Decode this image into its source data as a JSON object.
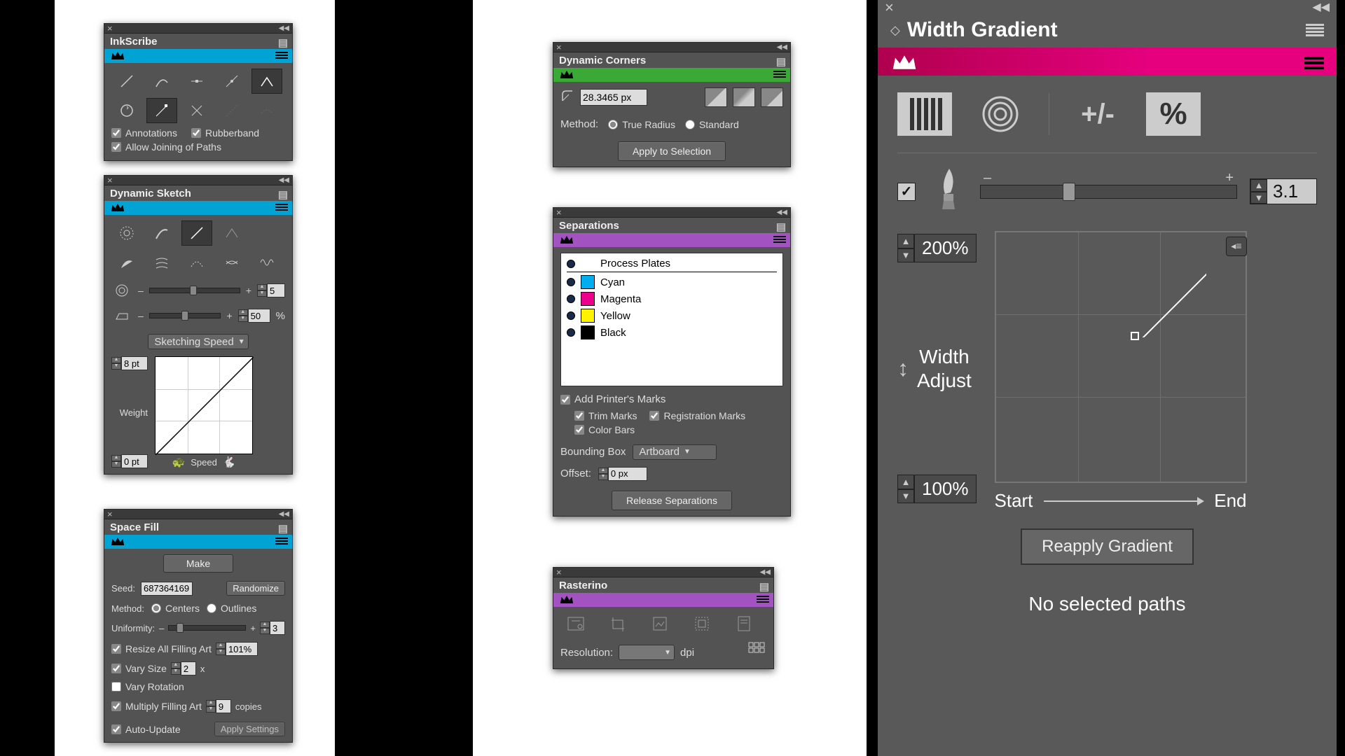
{
  "inkscribe": {
    "title": "InkScribe",
    "brand_color": "#00a3d4",
    "opts": {
      "annotations": "Annotations",
      "rubberband": "Rubberband",
      "joining": "Allow Joining of Paths"
    }
  },
  "dynsketch": {
    "title": "Dynamic Sketch",
    "brand_color": "#00a3d4",
    "val_a": "5",
    "val_b": "50",
    "unit_b": "%",
    "mode_label": "Sketching Speed",
    "pt_top": "8 pt",
    "pt_bot": "0 pt",
    "weight_label": "Weight",
    "speed_label": "Speed"
  },
  "spacefill": {
    "title": "Space Fill",
    "brand_color": "#00a3d4",
    "make": "Make",
    "seed_label": "Seed:",
    "seed_val": "687364169",
    "randomize": "Randomize",
    "method_label": "Method:",
    "centers": "Centers",
    "outlines": "Outlines",
    "uniformity_label": "Uniformity:",
    "uniformity_val": "3",
    "resize_label": "Resize All Filling Art",
    "resize_val": "101%",
    "vary_size_label": "Vary Size",
    "vary_size_val": "2",
    "vary_size_unit": "x",
    "vary_rotation": "Vary Rotation",
    "multiply_label": "Multiply Filling Art",
    "multiply_val": "9",
    "multiply_unit": "copies",
    "auto_update": "Auto-Update",
    "apply": "Apply Settings"
  },
  "dyncorners": {
    "title": "Dynamic Corners",
    "brand_color": "#3aa935",
    "radius_val": "28.3465 px",
    "method_label": "Method:",
    "true_radius": "True Radius",
    "standard": "Standard",
    "apply": "Apply to Selection"
  },
  "separations": {
    "title": "Separations",
    "brand_color": "#a352c1",
    "header": "Process Plates",
    "plates": [
      {
        "name": "Cyan",
        "color": "#00aeef"
      },
      {
        "name": "Magenta",
        "color": "#ec008c"
      },
      {
        "name": "Yellow",
        "color": "#fff200"
      },
      {
        "name": "Black",
        "color": "#000000"
      }
    ],
    "add_marks": "Add Printer's Marks",
    "trim": "Trim Marks",
    "reg": "Registration Marks",
    "bars": "Color Bars",
    "bbox_label": "Bounding Box",
    "bbox_val": "Artboard",
    "offset_label": "Offset:",
    "offset_val": "0 px",
    "release": "Release Separations"
  },
  "rasterino": {
    "title": "Rasterino",
    "brand_color": "#a352c1",
    "res_label": "Resolution:",
    "res_val": "",
    "res_unit": "dpi"
  },
  "widthgrad": {
    "title": "Width Gradient",
    "brush_val": "3.1",
    "pct_top": "200%",
    "pct_bot": "100%",
    "adjust_label": "Width\nAdjust",
    "start": "Start",
    "end": "End",
    "reapply": "Reapply Gradient",
    "status": "No selected paths"
  },
  "chart_data": [
    {
      "type": "line",
      "title": "Dynamic Sketch weight/speed curve",
      "xlabel": "Speed",
      "ylabel": "Weight",
      "x": [
        0,
        1
      ],
      "values": [
        0,
        1
      ],
      "xlim": [
        0,
        1
      ],
      "ylim": [
        0,
        1
      ]
    },
    {
      "type": "line",
      "title": "Width Gradient curve",
      "xlabel": "Start→End",
      "ylabel": "Width %",
      "x": [
        0,
        0.5,
        1
      ],
      "values": [
        100,
        150,
        200
      ],
      "xlim": [
        0,
        1
      ],
      "ylim": [
        100,
        200
      ]
    }
  ]
}
